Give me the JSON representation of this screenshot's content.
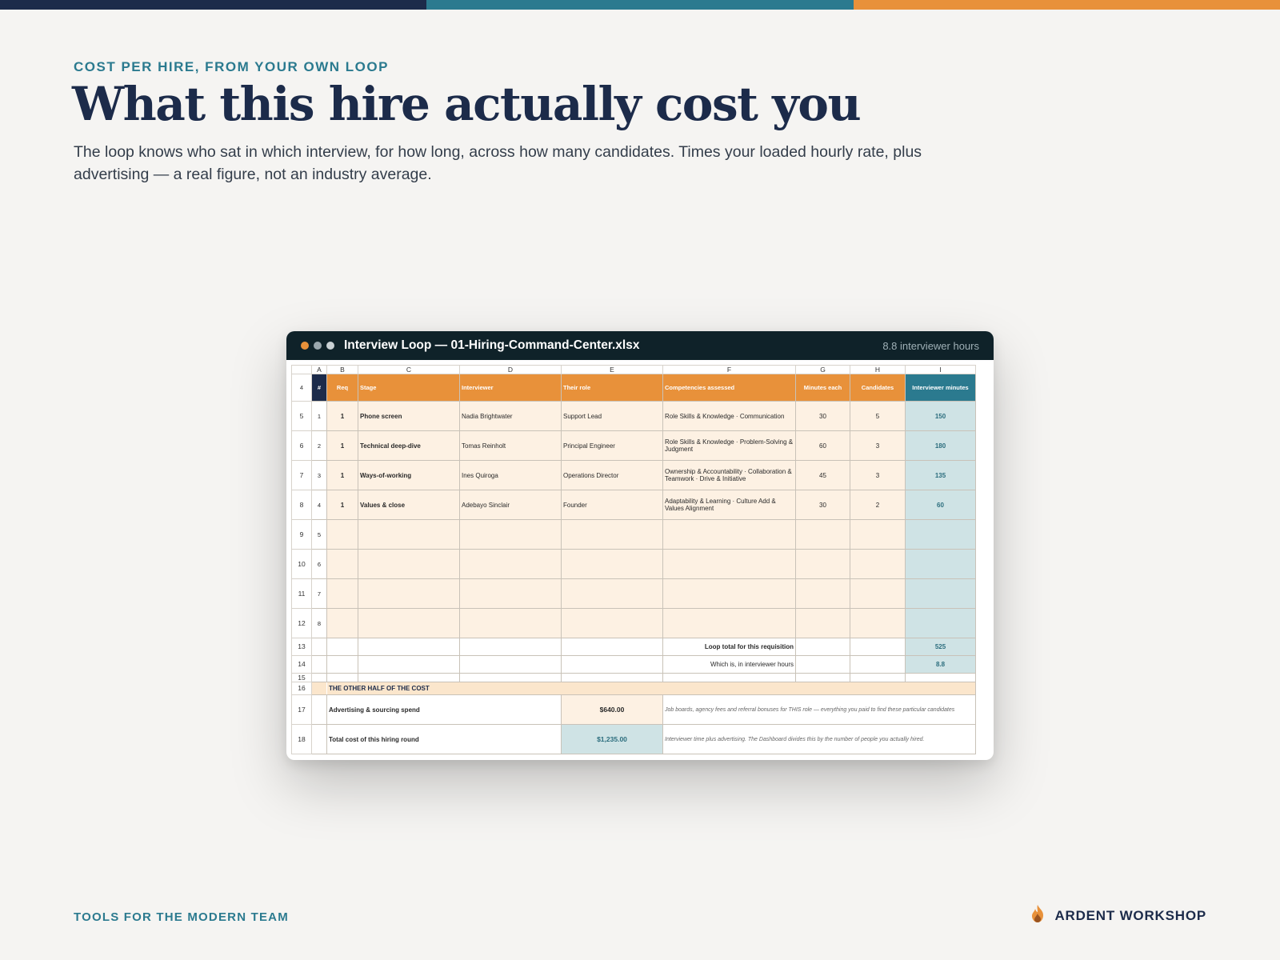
{
  "colors": {
    "navy": "#1c2b4a",
    "teal": "#2b7a8f",
    "orange": "#e8913a",
    "background": "#f5f4f2"
  },
  "eyebrow": "COST PER HIRE, FROM YOUR OWN LOOP",
  "headline": "What this hire actually cost you",
  "subtitle": "The loop knows who sat in which interview, for how long, across how many candidates. Times your loaded hourly rate, plus advertising — a real figure, not an industry average.",
  "window": {
    "title": "Interview Loop — 01-Hiring-Command-Center.xlsx",
    "meta": "8.8 interviewer hours"
  },
  "sheet": {
    "column_letters": [
      "A",
      "B",
      "C",
      "D",
      "E",
      "F",
      "G",
      "H",
      "I"
    ],
    "header_row_number": "4",
    "headers": {
      "idx": "#",
      "req": "Req",
      "stage": "Stage",
      "interviewer": "Interviewer",
      "role": "Their role",
      "competencies": "Competencies assessed",
      "minutes_each": "Minutes each",
      "candidates": "Candidates",
      "interviewer_minutes": "Interviewer minutes"
    },
    "rows": [
      {
        "rownum": "5",
        "idx": "1",
        "req": "1",
        "stage": "Phone screen",
        "interviewer": "Nadia Brightwater",
        "role": "Support Lead",
        "competencies": "Role Skills & Knowledge · Communication",
        "minutes_each": "30",
        "candidates": "5",
        "interviewer_minutes": "150"
      },
      {
        "rownum": "6",
        "idx": "2",
        "req": "1",
        "stage": "Technical deep-dive",
        "interviewer": "Tomas Reinholt",
        "role": "Principal Engineer",
        "competencies": "Role Skills & Knowledge · Problem-Solving & Judgment",
        "minutes_each": "60",
        "candidates": "3",
        "interviewer_minutes": "180"
      },
      {
        "rownum": "7",
        "idx": "3",
        "req": "1",
        "stage": "Ways-of-working",
        "interviewer": "Ines Quiroga",
        "role": "Operations Director",
        "competencies": "Ownership & Accountability · Collaboration & Teamwork · Drive & Initiative",
        "minutes_each": "45",
        "candidates": "3",
        "interviewer_minutes": "135"
      },
      {
        "rownum": "8",
        "idx": "4",
        "req": "1",
        "stage": "Values & close",
        "interviewer": "Adebayo Sinclair",
        "role": "Founder",
        "competencies": "Adaptability & Learning · Culture Add & Values Alignment",
        "minutes_each": "30",
        "candidates": "2",
        "interviewer_minutes": "60"
      },
      {
        "rownum": "9",
        "idx": "5",
        "req": "",
        "stage": "",
        "interviewer": "",
        "role": "",
        "competencies": "",
        "minutes_each": "",
        "candidates": "",
        "interviewer_minutes": ""
      },
      {
        "rownum": "10",
        "idx": "6",
        "req": "",
        "stage": "",
        "interviewer": "",
        "role": "",
        "competencies": "",
        "minutes_each": "",
        "candidates": "",
        "interviewer_minutes": ""
      },
      {
        "rownum": "11",
        "idx": "7",
        "req": "",
        "stage": "",
        "interviewer": "",
        "role": "",
        "competencies": "",
        "minutes_each": "",
        "candidates": "",
        "interviewer_minutes": ""
      },
      {
        "rownum": "12",
        "idx": "8",
        "req": "",
        "stage": "",
        "interviewer": "",
        "role": "",
        "competencies": "",
        "minutes_each": "",
        "candidates": "",
        "interviewer_minutes": ""
      }
    ],
    "totals": [
      {
        "rownum": "13",
        "label": "Loop total for this requisition",
        "value": "525"
      },
      {
        "rownum": "14",
        "label": "Which is, in interviewer hours",
        "value": "8.8"
      }
    ],
    "blank_row_number": "15",
    "section": {
      "rownum": "16",
      "title": "THE OTHER HALF OF THE COST"
    },
    "cost_rows": [
      {
        "rownum": "17",
        "label": "Advertising & sourcing spend",
        "value": "$640.00",
        "note": "Job boards, agency fees and referral bonuses for THIS role — everything you paid to find these particular candidates"
      },
      {
        "rownum": "18",
        "label": "Total cost of this hiring round",
        "value": "$1,235.00",
        "note": "Interviewer time plus advertising. The Dashboard divides this by the number of people you actually hired."
      }
    ]
  },
  "footer": {
    "tagline": "TOOLS FOR THE MODERN TEAM",
    "brand": "ARDENT WORKSHOP",
    "brand_icon": "flame-icon"
  }
}
